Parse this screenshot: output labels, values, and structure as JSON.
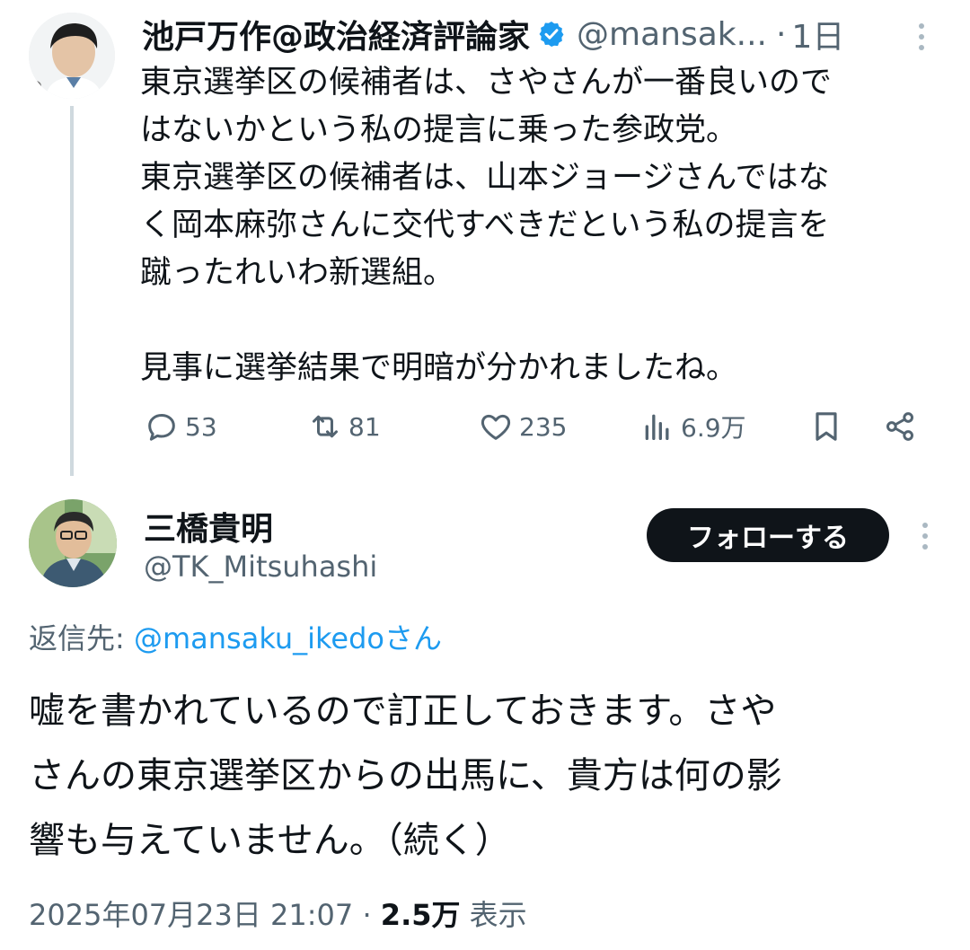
{
  "parent_tweet": {
    "author_name": "池戸万作@政治経済評論家",
    "handle": "@mansak...",
    "time_sep": "·",
    "time": "1日",
    "text": "東京選挙区の候補者は、さやさんが一番良いので\nはないかという私の提言に乗った参政党。\n東京選挙区の候補者は、山本ジョージさんではな\nく岡本麻弥さんに交代すべきだという私の提言を\n蹴ったれいわ新選組。\n\n見事に選挙結果で明暗が分かれましたね。",
    "stats": {
      "replies": "53",
      "retweets": "81",
      "likes": "235",
      "views": "6.9万"
    }
  },
  "reply_tweet": {
    "author_name": "三橋貴明",
    "handle": "@TK_Mitsuhashi",
    "follow_label": "フォローする",
    "reply_to_label": "返信先:",
    "reply_to_handle": "@mansaku_ikedoさん",
    "text": "嘘を書かれているので訂正しておきます。さや\nさんの東京選挙区からの出馬に、貴方は何の影\n響も与えていません。（続く）",
    "date": "2025年07月23日 21:07",
    "meta_sep": "·",
    "views_count": "2.5万",
    "views_label": "表示"
  },
  "icons": [
    "verified-badge-icon",
    "more-icon",
    "reply-icon",
    "retweet-icon",
    "like-icon",
    "views-icon",
    "bookmark-icon",
    "share-icon"
  ],
  "colors": {
    "verified": "#1d9bf0",
    "link": "#1d9bf0",
    "secondary_text": "#536471",
    "primary_text": "#0f1419",
    "follow_button_bg": "#0f1419",
    "thread_line": "#cfd9de"
  }
}
